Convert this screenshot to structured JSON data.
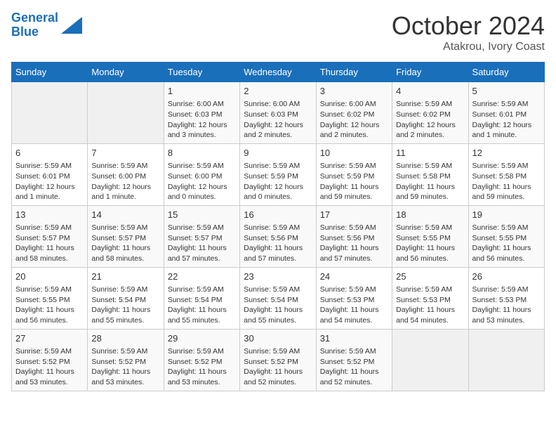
{
  "logo": {
    "line1": "General",
    "line2": "Blue"
  },
  "title": "October 2024",
  "location": "Atakrou, Ivory Coast",
  "days_of_week": [
    "Sunday",
    "Monday",
    "Tuesday",
    "Wednesday",
    "Thursday",
    "Friday",
    "Saturday"
  ],
  "weeks": [
    [
      {
        "day": "",
        "content": ""
      },
      {
        "day": "",
        "content": ""
      },
      {
        "day": "1",
        "content": "Sunrise: 6:00 AM\nSunset: 6:03 PM\nDaylight: 12 hours and 3 minutes."
      },
      {
        "day": "2",
        "content": "Sunrise: 6:00 AM\nSunset: 6:03 PM\nDaylight: 12 hours and 2 minutes."
      },
      {
        "day": "3",
        "content": "Sunrise: 6:00 AM\nSunset: 6:02 PM\nDaylight: 12 hours and 2 minutes."
      },
      {
        "day": "4",
        "content": "Sunrise: 5:59 AM\nSunset: 6:02 PM\nDaylight: 12 hours and 2 minutes."
      },
      {
        "day": "5",
        "content": "Sunrise: 5:59 AM\nSunset: 6:01 PM\nDaylight: 12 hours and 1 minute."
      }
    ],
    [
      {
        "day": "6",
        "content": "Sunrise: 5:59 AM\nSunset: 6:01 PM\nDaylight: 12 hours and 1 minute."
      },
      {
        "day": "7",
        "content": "Sunrise: 5:59 AM\nSunset: 6:00 PM\nDaylight: 12 hours and 1 minute."
      },
      {
        "day": "8",
        "content": "Sunrise: 5:59 AM\nSunset: 6:00 PM\nDaylight: 12 hours and 0 minutes."
      },
      {
        "day": "9",
        "content": "Sunrise: 5:59 AM\nSunset: 5:59 PM\nDaylight: 12 hours and 0 minutes."
      },
      {
        "day": "10",
        "content": "Sunrise: 5:59 AM\nSunset: 5:59 PM\nDaylight: 11 hours and 59 minutes."
      },
      {
        "day": "11",
        "content": "Sunrise: 5:59 AM\nSunset: 5:58 PM\nDaylight: 11 hours and 59 minutes."
      },
      {
        "day": "12",
        "content": "Sunrise: 5:59 AM\nSunset: 5:58 PM\nDaylight: 11 hours and 59 minutes."
      }
    ],
    [
      {
        "day": "13",
        "content": "Sunrise: 5:59 AM\nSunset: 5:57 PM\nDaylight: 11 hours and 58 minutes."
      },
      {
        "day": "14",
        "content": "Sunrise: 5:59 AM\nSunset: 5:57 PM\nDaylight: 11 hours and 58 minutes."
      },
      {
        "day": "15",
        "content": "Sunrise: 5:59 AM\nSunset: 5:57 PM\nDaylight: 11 hours and 57 minutes."
      },
      {
        "day": "16",
        "content": "Sunrise: 5:59 AM\nSunset: 5:56 PM\nDaylight: 11 hours and 57 minutes."
      },
      {
        "day": "17",
        "content": "Sunrise: 5:59 AM\nSunset: 5:56 PM\nDaylight: 11 hours and 57 minutes."
      },
      {
        "day": "18",
        "content": "Sunrise: 5:59 AM\nSunset: 5:55 PM\nDaylight: 11 hours and 56 minutes."
      },
      {
        "day": "19",
        "content": "Sunrise: 5:59 AM\nSunset: 5:55 PM\nDaylight: 11 hours and 56 minutes."
      }
    ],
    [
      {
        "day": "20",
        "content": "Sunrise: 5:59 AM\nSunset: 5:55 PM\nDaylight: 11 hours and 56 minutes."
      },
      {
        "day": "21",
        "content": "Sunrise: 5:59 AM\nSunset: 5:54 PM\nDaylight: 11 hours and 55 minutes."
      },
      {
        "day": "22",
        "content": "Sunrise: 5:59 AM\nSunset: 5:54 PM\nDaylight: 11 hours and 55 minutes."
      },
      {
        "day": "23",
        "content": "Sunrise: 5:59 AM\nSunset: 5:54 PM\nDaylight: 11 hours and 55 minutes."
      },
      {
        "day": "24",
        "content": "Sunrise: 5:59 AM\nSunset: 5:53 PM\nDaylight: 11 hours and 54 minutes."
      },
      {
        "day": "25",
        "content": "Sunrise: 5:59 AM\nSunset: 5:53 PM\nDaylight: 11 hours and 54 minutes."
      },
      {
        "day": "26",
        "content": "Sunrise: 5:59 AM\nSunset: 5:53 PM\nDaylight: 11 hours and 53 minutes."
      }
    ],
    [
      {
        "day": "27",
        "content": "Sunrise: 5:59 AM\nSunset: 5:52 PM\nDaylight: 11 hours and 53 minutes."
      },
      {
        "day": "28",
        "content": "Sunrise: 5:59 AM\nSunset: 5:52 PM\nDaylight: 11 hours and 53 minutes."
      },
      {
        "day": "29",
        "content": "Sunrise: 5:59 AM\nSunset: 5:52 PM\nDaylight: 11 hours and 53 minutes."
      },
      {
        "day": "30",
        "content": "Sunrise: 5:59 AM\nSunset: 5:52 PM\nDaylight: 11 hours and 52 minutes."
      },
      {
        "day": "31",
        "content": "Sunrise: 5:59 AM\nSunset: 5:52 PM\nDaylight: 11 hours and 52 minutes."
      },
      {
        "day": "",
        "content": ""
      },
      {
        "day": "",
        "content": ""
      }
    ]
  ]
}
